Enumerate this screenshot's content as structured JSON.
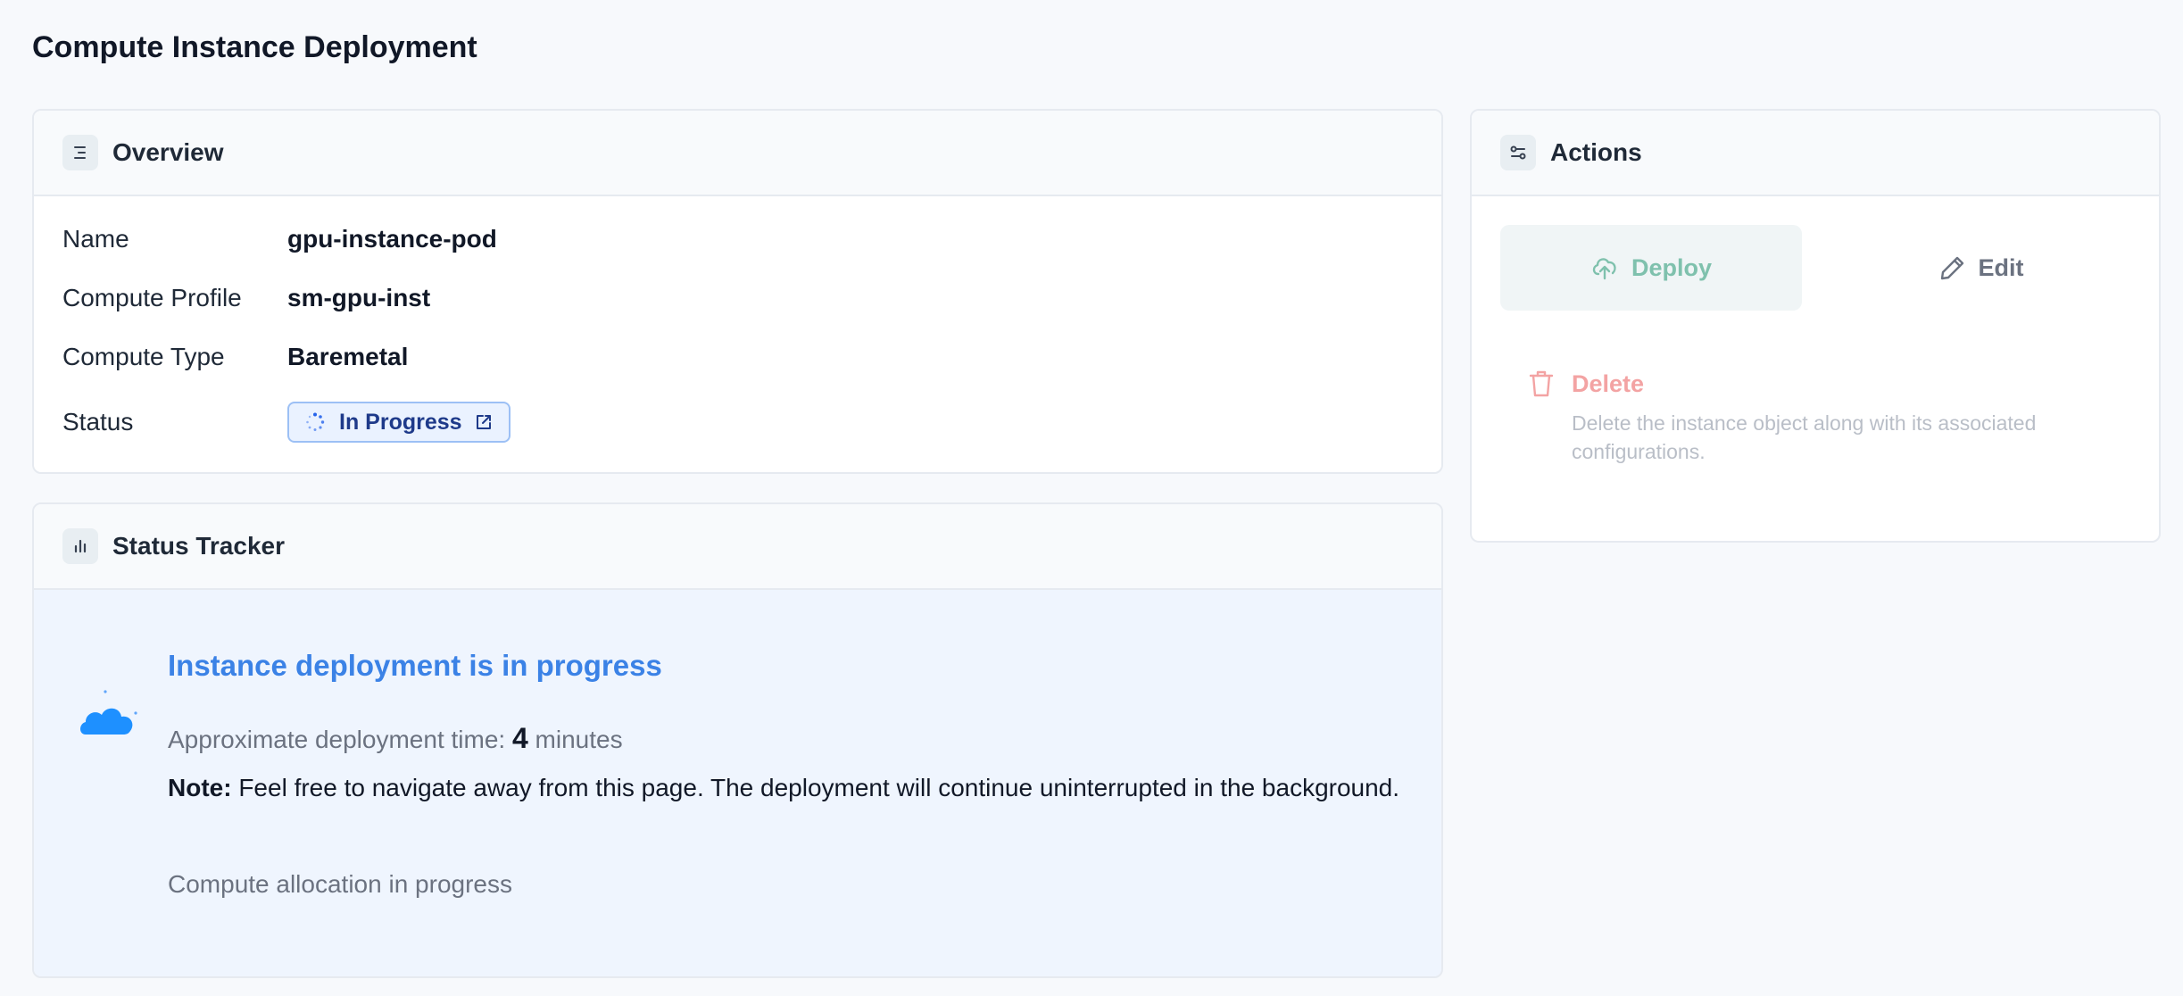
{
  "page": {
    "title": "Compute Instance Deployment"
  },
  "overview": {
    "title": "Overview",
    "icon": "list-icon",
    "rows": [
      {
        "label": "Name",
        "value": "gpu-instance-pod"
      },
      {
        "label": "Compute Profile",
        "value": "sm-gpu-inst"
      },
      {
        "label": "Compute Type",
        "value": "Baremetal"
      },
      {
        "label": "Status",
        "value": "In Progress"
      }
    ],
    "status_icons": {
      "left": "spinner-icon",
      "right": "external-link-icon"
    }
  },
  "tracker": {
    "title": "Status Tracker",
    "icon": "bar-chart-icon",
    "heading": "Instance deployment is in progress",
    "approx_label": "Approximate deployment time:",
    "approx_value": "4",
    "approx_unit": "minutes",
    "note_label": "Note:",
    "note_text": "Feel free to navigate away from this page. The deployment will continue uninterrupted in the background.",
    "allocation_text": "Compute allocation in progress",
    "illustration": "cloud-icon"
  },
  "actions": {
    "title": "Actions",
    "icon": "sliders-icon",
    "deploy_label": "Deploy",
    "edit_label": "Edit",
    "delete_label": "Delete",
    "delete_description": "Delete the instance object along with its associated configurations."
  },
  "colors": {
    "accent_blue": "#3b82e6",
    "deploy_green": "#7fc1ad",
    "delete_red": "#f3a3a3",
    "status_pill_bg": "#eaf2ff",
    "tracker_bg": "#eff5fe"
  }
}
